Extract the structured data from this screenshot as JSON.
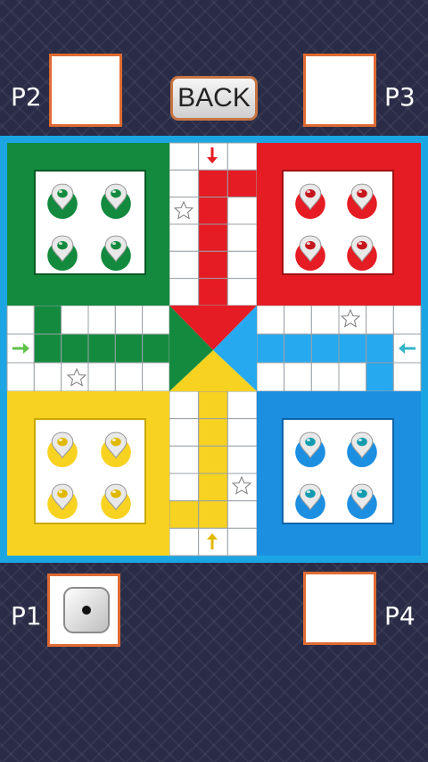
{
  "header": {
    "back_label": "BACK"
  },
  "players": {
    "p1": {
      "label": "P1",
      "color": "#f7d221",
      "slot": "bottom-left"
    },
    "p2": {
      "label": "P2",
      "color": "#138a3e",
      "slot": "top-left"
    },
    "p3": {
      "label": "P3",
      "color": "#e51c23",
      "slot": "top-right"
    },
    "p4": {
      "label": "P4",
      "color": "#1d8fe1",
      "slot": "bottom-right"
    }
  },
  "dice": {
    "face_value": 1,
    "owner": "P1"
  },
  "board": {
    "frame_color": "#1ba6e3",
    "tokens_per_player": 4,
    "safe_star_icon": "star-icon",
    "entry_arrows": [
      "arrow-down-icon",
      "arrow-up-icon",
      "arrow-right-icon",
      "arrow-left-icon"
    ]
  }
}
